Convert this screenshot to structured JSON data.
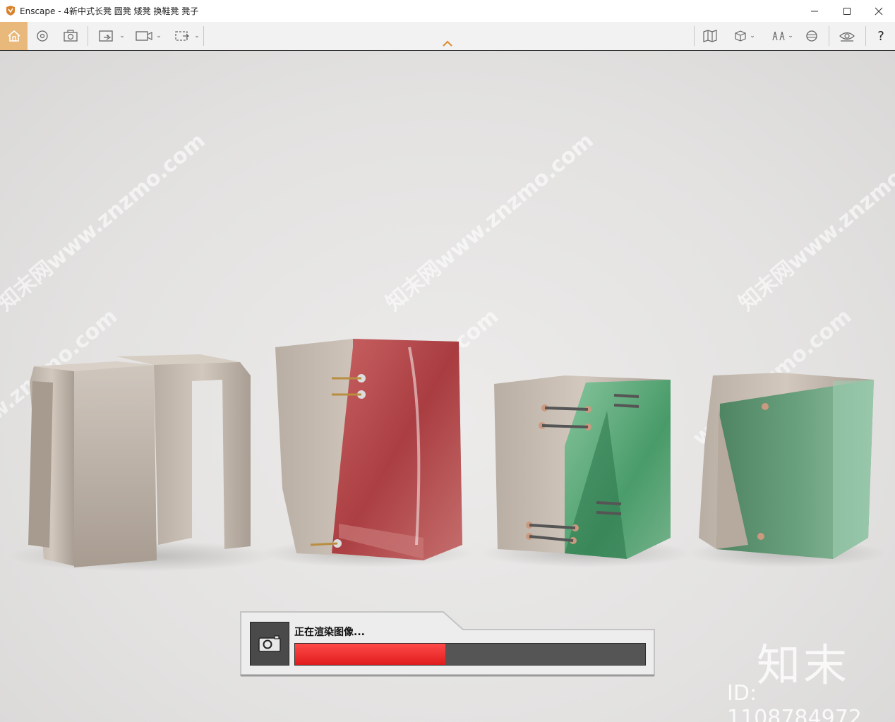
{
  "window": {
    "title": "Enscape - 4新中式长凳 圆凳 矮凳 换鞋凳 凳子",
    "minimize_icon": "minimize-icon",
    "maximize_icon": "maximize-icon",
    "close_icon": "close-icon"
  },
  "toolbar": {
    "left_buttons": [
      "home-icon",
      "orbit-icon",
      "screenshot-icon",
      "capture-icon",
      "video-icon",
      "batch-icon"
    ],
    "right_buttons": [
      "map-icon",
      "cube-icon",
      "view-icon",
      "sun-icon",
      "eye-icon"
    ],
    "help_label": "?",
    "accent_color": "#e8b97a"
  },
  "viewport": {
    "watermarks": [
      "知末网www.znzmo.com",
      "知末网www.znzmo.com",
      "知末网www.znzmo.com",
      "www.znzmo.com",
      "www.znzmo.com",
      "www.znzmo.com"
    ]
  },
  "render": {
    "label": "正在渲染图像...",
    "progress": 0.43,
    "bar_color": "#ff3b3b"
  },
  "brand": {
    "logo": "知末",
    "id": "ID: 1108784972"
  }
}
